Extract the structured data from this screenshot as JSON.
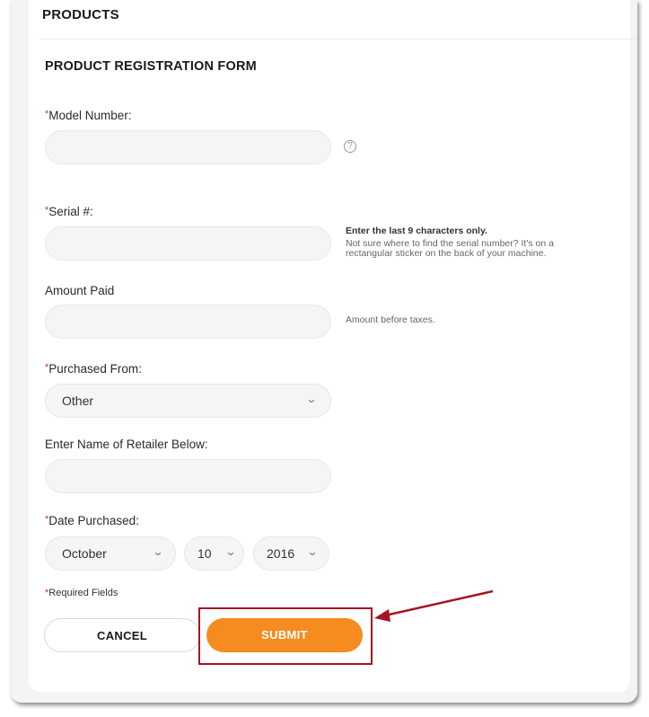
{
  "header": {
    "title": "PRODUCTS"
  },
  "form": {
    "title": "PRODUCT REGISTRATION FORM",
    "required_marker": "*",
    "model_number": {
      "label": "Model Number:",
      "value": "",
      "help_icon": "?"
    },
    "serial": {
      "label": "Serial #:",
      "value": "",
      "hint_strong": "Enter the last 9 characters only.",
      "hint_line1": "Not sure where to find the serial number? It's on a",
      "hint_line2": "rectangular sticker on the back of your machine."
    },
    "amount_paid": {
      "label": "Amount Paid",
      "value": "",
      "hint": "Amount before taxes."
    },
    "purchased_from": {
      "label": "Purchased From:",
      "selected": "Other"
    },
    "retailer_name": {
      "label": "Enter Name of Retailer Below:",
      "value": ""
    },
    "date_purchased": {
      "label": "Date Purchased:",
      "month": "October",
      "day": "10",
      "year": "2016"
    },
    "required_note": "Required Fields",
    "cancel_label": "CANCEL",
    "submit_label": "SUBMIT"
  },
  "annotation": {
    "color": "#a31621"
  },
  "colors": {
    "accent": "#f68b1f"
  }
}
